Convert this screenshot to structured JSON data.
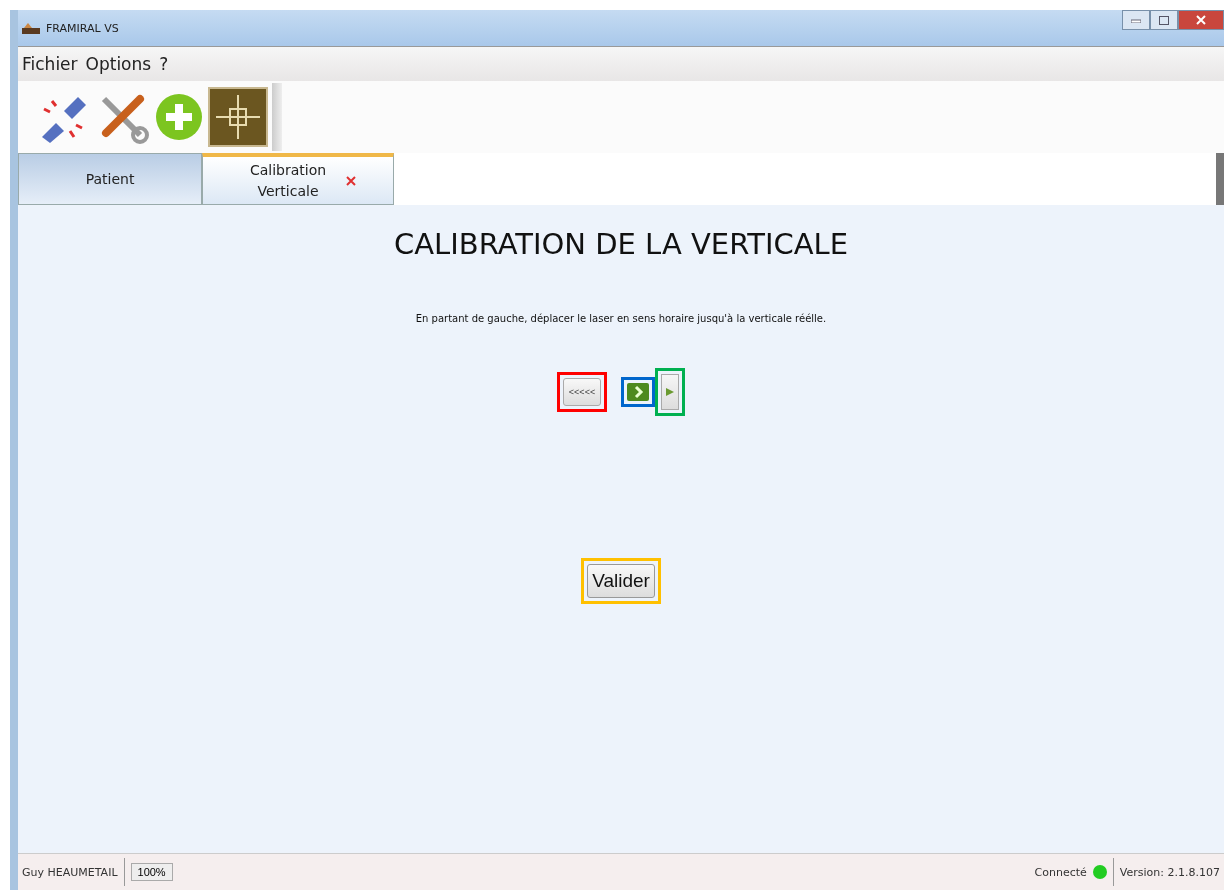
{
  "window": {
    "title": "FRAMIRAL VS"
  },
  "menu": [
    "Fichier",
    "Options",
    "?"
  ],
  "tabs": [
    {
      "label": "Patient",
      "selected": false,
      "closable": false
    },
    {
      "label": "Calibration\nVerticale",
      "selected": true,
      "closable": true
    }
  ],
  "heading": "CALIBRATION DE LA VERTICALE",
  "instruction": "En partant de gauche, déplacer le laser en sens horaire jusqu'à la verticale réélle.",
  "controls": [
    {
      "kind": "text",
      "label": "<<<<<",
      "color": "#ff0000"
    },
    {
      "kind": "step",
      "color": "#0066cc"
    },
    {
      "kind": "play",
      "color": "#00b050"
    }
  ],
  "submit": {
    "label": "Valider",
    "color": "#ffc000"
  },
  "status_bar": {
    "user": "Guy HEAUMETAIL",
    "zoom": "100%",
    "connection": "Connecté",
    "connected": true,
    "version": "Version: 2.1.8.107"
  }
}
